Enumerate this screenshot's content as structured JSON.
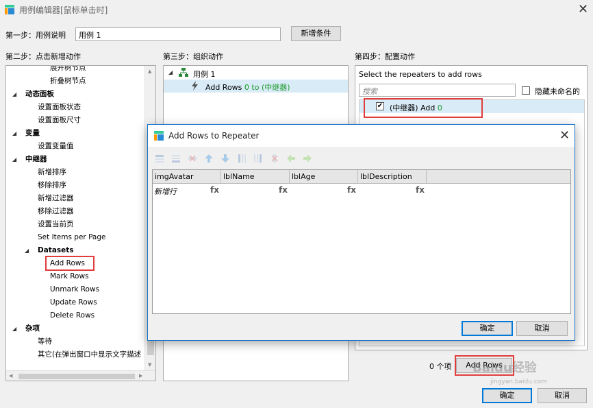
{
  "window": {
    "title": "用例编辑器[鼠标单击时]",
    "close": "✕"
  },
  "step1": {
    "label": "第一步：用例说明",
    "value": "用例 1",
    "add_condition": "新增条件"
  },
  "step2": {
    "label": "第二步：点击新增动作",
    "items": [
      {
        "text": "展开树节点",
        "level": 3
      },
      {
        "text": "折叠树节点",
        "level": 3
      },
      {
        "text": "动态面板",
        "level": 1
      },
      {
        "text": "设置面板状态",
        "level": 2
      },
      {
        "text": "设置面板尺寸",
        "level": 2
      },
      {
        "text": "变量",
        "level": 1
      },
      {
        "text": "设置变量值",
        "level": 2
      },
      {
        "text": "中继器",
        "level": 1
      },
      {
        "text": "新增排序",
        "level": 2
      },
      {
        "text": "移除排序",
        "level": 2
      },
      {
        "text": "新增过滤器",
        "level": 2
      },
      {
        "text": "移除过滤器",
        "level": 2
      },
      {
        "text": "设置当前页",
        "level": 2
      },
      {
        "text": "Set Items per Page",
        "level": 2
      },
      {
        "text": "Datasets",
        "level": 1.5
      },
      {
        "text": "Add Rows",
        "level": 3
      },
      {
        "text": "Mark Rows",
        "level": 3
      },
      {
        "text": "Unmark Rows",
        "level": 3
      },
      {
        "text": "Update Rows",
        "level": 3
      },
      {
        "text": "Delete Rows",
        "level": 3
      },
      {
        "text": "杂项",
        "level": 1
      },
      {
        "text": "等待",
        "level": 2
      },
      {
        "text": "其它(在弹出窗口中显示文字描述",
        "level": 2
      }
    ]
  },
  "step3": {
    "label": "第三步：组织动作",
    "case": "用例 1",
    "action_prefix": "Add Rows ",
    "action_suffix": "0 to (中继器)"
  },
  "step4": {
    "label": "第四步：配置动作",
    "prompt": "Select the repeaters to add rows",
    "search_placeholder": "搜索",
    "hide_unnamed": "隐藏未命名的",
    "repeater_item_prefix": "(中继器) Add ",
    "repeater_item_count": "0",
    "count_label": "0 个项",
    "add_rows_button": "Add Rows"
  },
  "dialog": {
    "title": "Add Rows to Repeater",
    "columns": [
      "imgAvatar",
      "lblName",
      "lblAge",
      "lblDescription"
    ],
    "new_row_label": "新增行",
    "fx": "fx",
    "ok": "确定",
    "cancel": "取消"
  },
  "footer": {
    "ok": "确定",
    "cancel": "取消"
  },
  "watermark": {
    "text": "Baidu经验",
    "url": "jingyan.baidu.com"
  }
}
